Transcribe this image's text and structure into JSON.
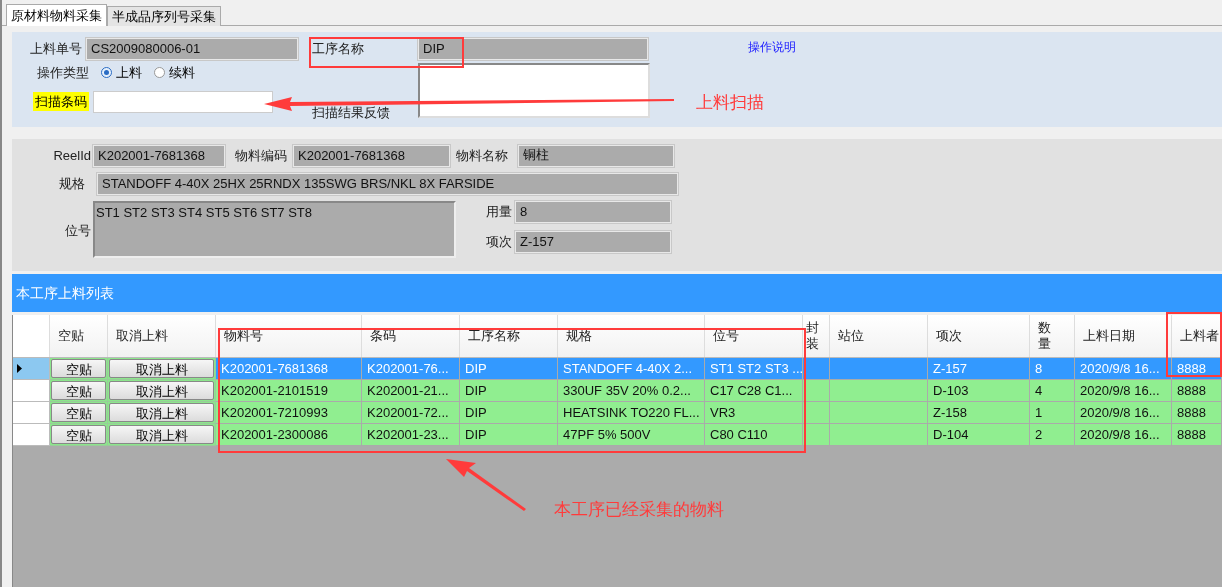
{
  "tabs": [
    {
      "label": "原材料物料采集",
      "selected": true
    },
    {
      "label": "半成品序列号采集",
      "selected": false
    }
  ],
  "form": {
    "order_label": "上料单号",
    "order_value": "CS2009080006-01",
    "process_label": "工序名称",
    "process_value": "DIP",
    "help_link": "操作说明",
    "op_type_label": "操作类型",
    "op_types": [
      {
        "label": "上料",
        "selected": true
      },
      {
        "label": "续料",
        "selected": false
      }
    ],
    "scan_label": "扫描条码",
    "feedback_label": "扫描结果反馈"
  },
  "detail": {
    "reel_label": "ReelId",
    "reel_value": "K202001-7681368",
    "code_label": "物料编码",
    "code_value": "K202001-7681368",
    "name_label": "物料名称",
    "name_value": "铜柱",
    "spec_label": "规格",
    "spec_value": "STANDOFF 4-40X 25HX 25RNDX 135SWG BRS/NKL 8X FARSIDE",
    "position_label": "位号",
    "position_value": "ST1 ST2 ST3 ST4 ST5 ST6 ST7 ST8",
    "qty_label": "用量",
    "qty_value": "8",
    "item_label": "项次",
    "item_value": "Z-157"
  },
  "list": {
    "title": "本工序上料列表",
    "columns": [
      "空贴",
      "取消上料",
      "物料号",
      "条码",
      "工序名称",
      "规格",
      "位号",
      "封装",
      "站位",
      "项次",
      "数量",
      "上料日期",
      "上料者"
    ],
    "rows": [
      {
        "selected": true,
        "buttons": [
          "空贴",
          "取消上料"
        ],
        "material": "K202001-7681368",
        "barcode": "K202001-76...",
        "process": "DIP",
        "spec": "STANDOFF 4-40X 2...",
        "position": "ST1 ST2 ST3 ...",
        "item": "Z-157",
        "qty": "8",
        "date": "2020/9/8 16...",
        "operator": "8888"
      },
      {
        "selected": false,
        "buttons": [
          "空贴",
          "取消上料"
        ],
        "material": "K202001-2101519",
        "barcode": "K202001-21...",
        "process": "DIP",
        "spec": "330UF 35V 20% 0.2...",
        "position": "C17 C28 C1...",
        "item": "D-103",
        "qty": "4",
        "date": "2020/9/8 16...",
        "operator": "8888"
      },
      {
        "selected": false,
        "buttons": [
          "空贴",
          "取消上料"
        ],
        "material": "K202001-7210993",
        "barcode": "K202001-72...",
        "process": "DIP",
        "spec": "HEATSINK TO220 FL...",
        "position": "VR3",
        "item": "Z-158",
        "qty": "1",
        "date": "2020/9/8 16...",
        "operator": "8888"
      },
      {
        "selected": false,
        "buttons": [
          "空贴",
          "取消上料"
        ],
        "material": "K202001-2300086",
        "barcode": "K202001-23...",
        "process": "DIP",
        "spec": "47PF 5% 500V",
        "position": "C80 C110",
        "item": "D-104",
        "qty": "2",
        "date": "2020/9/8 16...",
        "operator": "8888"
      }
    ]
  },
  "annotations": [
    {
      "text": "上料扫描"
    },
    {
      "text": "本工序已经采集的物料"
    }
  ]
}
